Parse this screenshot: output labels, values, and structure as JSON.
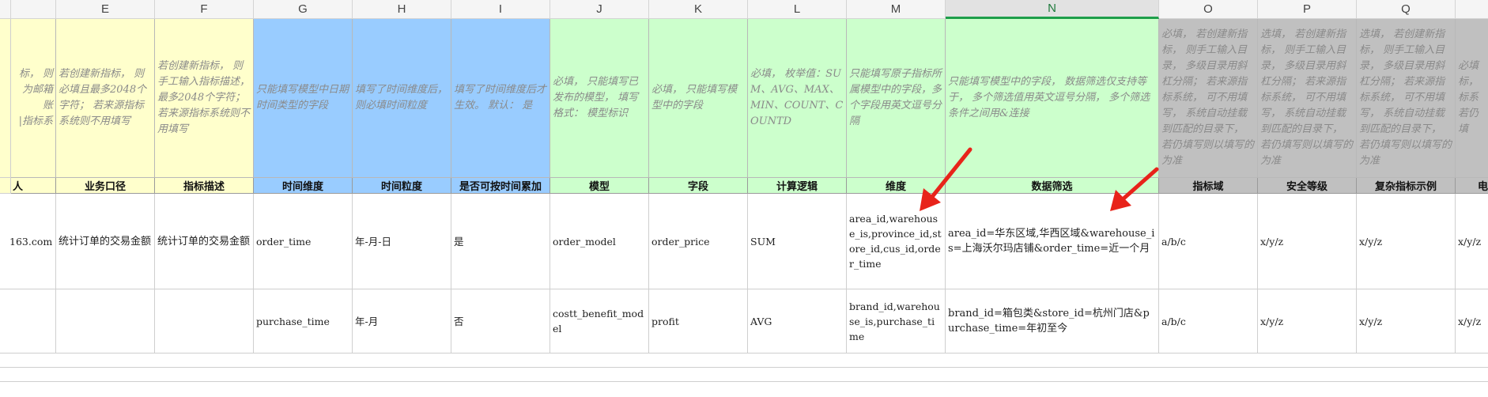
{
  "columns": [
    "E",
    "F",
    "G",
    "H",
    "I",
    "J",
    "K",
    "L",
    "M",
    "N",
    "O",
    "P",
    "Q"
  ],
  "selected_column": "N",
  "descriptions": {
    "D": "标， 则为邮箱账\n|指标系",
    "E": "若创建新指标， 则必填且最多2048个字符； 若来源指标系统则不用填写",
    "F": "若创建新指标， 则手工输入指标描述， 最多2048个字符； 若来源指标系统则不用填写",
    "G": "只能填写模型中日期时间类型的字段",
    "H": "填写了时间维度后， 则必填时间粒度",
    "I": "填写了时间维度后才生效。 默认： 是",
    "J": "必填， 只能填写已发布的模型， 填写格式： 模型标识",
    "K": "必填， 只能填写模型中的字段",
    "L": "必填， 枚举值：SUM、AVG、MAX、MIN、COUNT、COUNTD",
    "M": "只能填写原子指标所属模型中的字段，多个字段用英文逗号分隔",
    "N": "只能填写模型中的字段， 数据筛选仅支持等于， 多个筛选值用英文逗号分隔， 多个筛选条件之间用&连接",
    "O": "必填， 若创建新指标， 则手工输入目录， 多级目录用斜杠分隔； 若来源指标系统， 可不用填写， 系统自动挂载到匹配的目录下， 若仍填写则以填写的为准",
    "P": "选填， 若创建新指标， 则手工输入目录， 多级目录用斜杠分隔； 若来源指标系统， 可不用填写， 系统自动挂载到匹配的目录下， 若仍填写则以填写的为准",
    "Q": "选填， 若创建新指标， 则手工输入目录， 多级目录用斜杠分隔； 若来源指标系统， 可不用填写， 系统自动挂载到匹配的目录下， 若仍填写则以填写的为准",
    "R": "必填\n标，\n标系\n若仍填"
  },
  "headers": {
    "D": "人",
    "E": "业务口径",
    "F": "指标描述",
    "G": "时间维度",
    "H": "时间粒度",
    "I": "是否可按时间累加",
    "J": "模型",
    "K": "字段",
    "L": "计算逻辑",
    "M": "维度",
    "N": "数据筛选",
    "O": "指标域",
    "P": "安全等级",
    "Q": "复杂指标示例",
    "R": "电"
  },
  "rows": [
    {
      "D": "163.com",
      "E": "统计订单的交易金额",
      "F": "统计订单的交易金额",
      "G": "order_time",
      "H": "年-月-日",
      "I": "是",
      "J": "order_model",
      "K": "order_price",
      "L": "SUM",
      "M": "area_id,warehouse_is,province_id,store_id,cus_id,order_time",
      "N": "area_id=华东区域,华西区域&warehouse_is=上海沃尔玛店铺&order_time=近一个月",
      "O": "a/b/c",
      "P": "x/y/z",
      "Q": "x/y/z",
      "R": "x/y/z"
    },
    {
      "D": "",
      "E": "",
      "F": "",
      "G": "purchase_time",
      "H": "年-月",
      "I": "否",
      "J": "costt_benefit_model",
      "K": "profit",
      "L": "AVG",
      "M": "brand_id,warehouse_is,purchase_time",
      "N": "brand_id=箱包类&store_id=杭州门店&purchase_time=年初至今",
      "O": "a/b/c",
      "P": "x/y/z",
      "Q": "x/y/z",
      "R": "x/y/z"
    }
  ],
  "colors": {
    "yellow": "#ffffcc",
    "blue": "#99ccff",
    "green": "#ccffcc",
    "gray": "#c0c0c0",
    "arrow": "#e8231a",
    "selected_header": "#1e9e4a"
  },
  "annotations": [
    "red-arrow-to-dimension-column",
    "red-arrow-to-data-filter-column"
  ]
}
